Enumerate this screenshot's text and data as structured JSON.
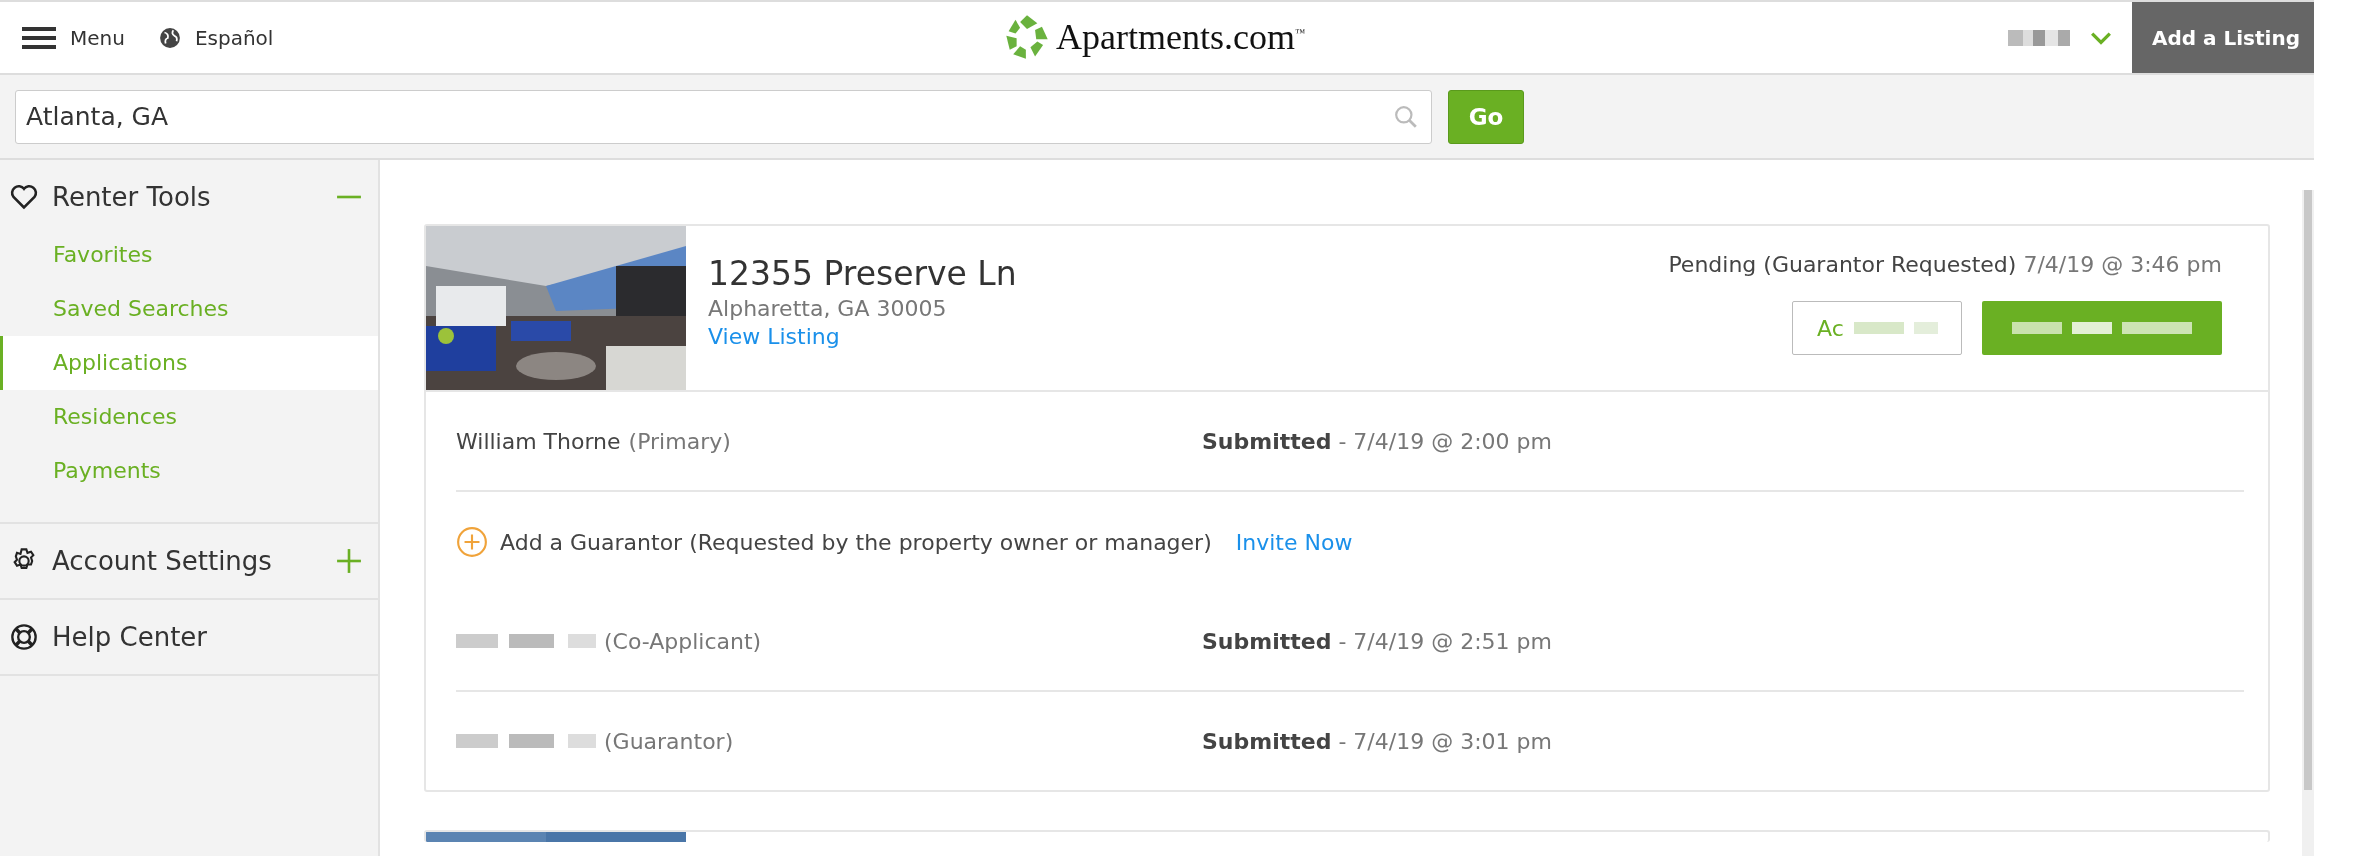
{
  "header": {
    "menu_label": "Menu",
    "language": "Español",
    "logo_text": "Apartments.com",
    "logo_mark": "™",
    "add_listing": "Add a Listing"
  },
  "search": {
    "value": "Atlanta, GA",
    "button": "Go"
  },
  "sidebar": {
    "sections": [
      {
        "kind": "group",
        "label": "Renter Tools",
        "expanded": true,
        "children": [
          {
            "label": "Favorites",
            "selected": false
          },
          {
            "label": "Saved Searches",
            "selected": false
          },
          {
            "label": "Applications",
            "selected": true
          },
          {
            "label": "Residences",
            "selected": false
          },
          {
            "label": "Payments",
            "selected": false
          }
        ]
      },
      {
        "kind": "group",
        "label": "Account Settings",
        "expanded": false
      },
      {
        "kind": "link",
        "label": "Help Center"
      }
    ]
  },
  "applications": [
    {
      "kind": "full",
      "address": "12355 Preserve Ln",
      "city": "Alpharetta, GA 30005",
      "link": "View Listing",
      "status": "Pending (Guarantor Requested)",
      "status_time": "7/4/19 @ 3:46 pm",
      "buttons": [
        {
          "kind": "outline",
          "label": "Ac"
        },
        {
          "kind": "primary"
        }
      ],
      "rows": [
        {
          "kind": "applicant",
          "name": "William Thorne",
          "role": "(Primary)",
          "status": "Submitted",
          "time": "- 7/4/19 @ 2:00 pm"
        },
        {
          "kind": "invite",
          "text": "Add a Guarantor (Requested by the property owner or manager)",
          "link": "Invite Now"
        },
        {
          "kind": "applicant",
          "role": "(Co-Applicant)",
          "status": "Submitted",
          "time": "- 7/4/19 @ 2:51 pm"
        },
        {
          "kind": "applicant",
          "role": "(Guarantor)",
          "status": "Submitted",
          "time": "- 7/4/19 @ 3:01 pm"
        }
      ]
    },
    {
      "kind": "partial"
    }
  ]
}
